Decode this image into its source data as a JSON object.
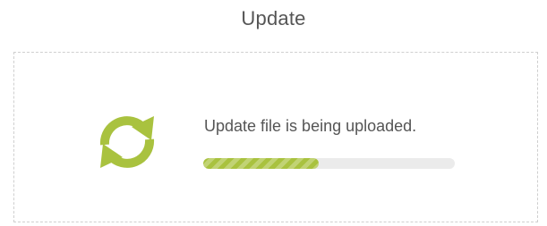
{
  "dialog": {
    "title": "Update",
    "message": "Update file is being uploaded.",
    "progress_percent": 46,
    "icon": "refresh-icon"
  },
  "colors": {
    "accent": "#a9c23f",
    "track": "#ebebeb",
    "text": "#555555",
    "border": "#cfcfcf"
  }
}
